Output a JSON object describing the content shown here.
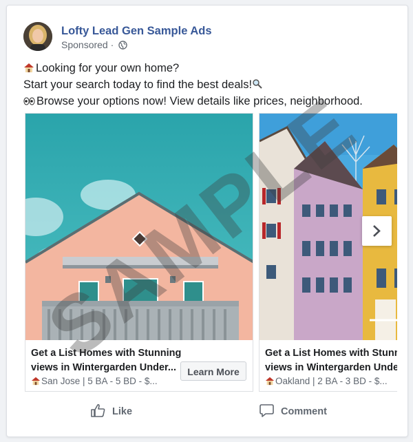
{
  "post": {
    "page_name": "Lofty Lead Gen Sample Ads",
    "sponsored_label": "Sponsored",
    "separator": "·",
    "text_line_1": "Looking for your own home?",
    "text_line_2": "Start your search today to find the best deals!",
    "text_line_3": "Browse your options now! View details like prices, neighborhood."
  },
  "carousel": [
    {
      "title_line_1": "Get a List Homes with Stunning",
      "title_line_2": "views in Wintergarden Under...",
      "subtitle": "San Jose | 5 BA - 5 BD - $...",
      "cta": "Learn More"
    },
    {
      "title_line_1": "Get a List Homes with Stunnin",
      "title_line_2": "views in Wintergarden Under",
      "subtitle": "Oakland | 2 BA - 3 BD - $..."
    }
  ],
  "actions": {
    "like": "Like",
    "comment": "Comment"
  },
  "watermark": "SAMPLE",
  "colors": {
    "page_name": "#385898",
    "sky": "#33aab0",
    "house": "#f2b5a0"
  },
  "icons": [
    "globe-icon",
    "house-emoji-icon",
    "magnifier-icon",
    "eyes-icon",
    "chevron-right-icon",
    "thumbs-up-icon",
    "comment-icon"
  ]
}
